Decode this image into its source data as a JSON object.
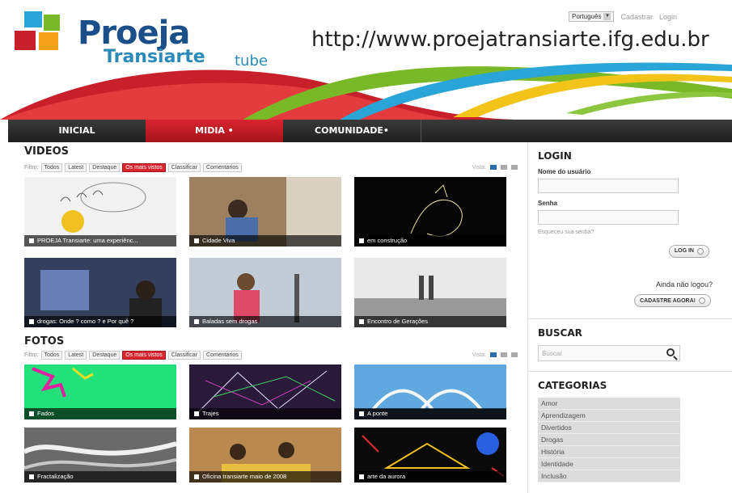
{
  "header": {
    "logo_line1": "Proeja",
    "logo_line2": "Transiarte",
    "logo_suffix": "tube",
    "url": "http://www.proejatransiarte.ifg.edu.br",
    "language": "Português",
    "register_link": "Cadastrar",
    "login_link": "Login"
  },
  "nav": {
    "items": [
      "INICIAL",
      "MIDIA  •",
      "COMUNIDADE•"
    ]
  },
  "videos": {
    "title": "VIDEOS",
    "filter_label": "Filtro:",
    "filters": [
      "Todos",
      "Latest",
      "Destaque",
      "Os mais vistos",
      "Classificar",
      "Comentarios"
    ],
    "view_label": "Vista:",
    "items": [
      {
        "caption": "PROEJA Transiarte: uma experiênc..."
      },
      {
        "caption": "Cidade Viva"
      },
      {
        "caption": "em construção"
      },
      {
        "caption": "drogas: Onde ? como ? e Por quê ?"
      },
      {
        "caption": "Baladas sem drogas"
      },
      {
        "caption": "Encontro de Gerações"
      }
    ]
  },
  "photos": {
    "title": "FOTOS",
    "filter_label": "Filtro:",
    "filters": [
      "Todos",
      "Latest",
      "Destaque",
      "Os mais vistos",
      "Classificar",
      "Comentarios"
    ],
    "view_label": "Vista:",
    "items": [
      {
        "caption": "Fados"
      },
      {
        "caption": "Trajes"
      },
      {
        "caption": "A ponte"
      },
      {
        "caption": "Fractalização"
      },
      {
        "caption": "Oficina transiarte maio de 2008"
      },
      {
        "caption": "arte da aurora"
      }
    ]
  },
  "sidebar": {
    "login_title": "LOGIN",
    "username_label": "Nome do usuário",
    "password_label": "Senha",
    "forgot_link": "Esqueceu sua senha?",
    "login_button": "LOG IN",
    "not_logged": "Ainda não logou?",
    "register_button": "CADASTRE AGORA!",
    "search_title": "BUSCAR",
    "search_placeholder": "Buscar",
    "categories_title": "CATEGORIAS",
    "categories": [
      "Amor",
      "Aprendizagem",
      "Divertidos",
      "Drogas",
      "História",
      "Identidade",
      "Inclusão"
    ]
  },
  "colors": {
    "brand_blue": "#1a4f8a",
    "accent_red": "#d8252e",
    "nav_dark": "#2a2a2a"
  }
}
